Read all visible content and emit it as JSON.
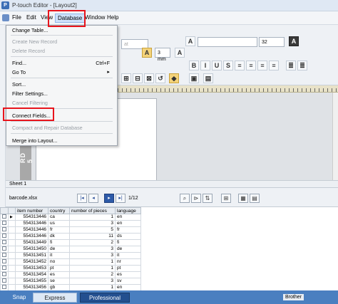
{
  "window": {
    "title": "P-touch Editor - [Layout2]"
  },
  "menubar": {
    "items": [
      "File",
      "Edit",
      "View",
      "Database",
      "Window",
      "Help"
    ],
    "active": "Database"
  },
  "database_menu": {
    "items": [
      {
        "label": "Change Table...",
        "shortcut": "",
        "disabled": false
      },
      {
        "label": "Create New Record",
        "shortcut": "",
        "disabled": true
      },
      {
        "label": "Delete Record",
        "shortcut": "",
        "disabled": true
      },
      {
        "label": "Find...",
        "shortcut": "Ctrl+F",
        "disabled": false
      },
      {
        "label": "Go To",
        "shortcut": "▸",
        "disabled": false
      },
      {
        "label": "Sort...",
        "shortcut": "",
        "disabled": false
      },
      {
        "label": "Filter Settings...",
        "shortcut": "",
        "disabled": false
      },
      {
        "label": "Cancel Filtering",
        "shortcut": "",
        "disabled": true
      },
      {
        "label": "Connect Fields...",
        "shortcut": "",
        "disabled": false
      },
      {
        "label": "Compact and Repair Database",
        "shortcut": "",
        "disabled": true
      },
      {
        "label": "Merge into Layout...",
        "shortcut": "",
        "disabled": false
      }
    ]
  },
  "toolbar": {
    "font_size": "32",
    "length": "3 mm"
  },
  "canvas": {
    "vertical_text": "RD 5",
    "sheet_tab": "Sheet 1"
  },
  "database": {
    "file": "barcode.xlsx",
    "page_indicator": "1/12",
    "columns": [
      "item number",
      "country",
      "number of pieces",
      "language"
    ],
    "rows": [
      [
        "554313446",
        "ca",
        "1",
        "en"
      ],
      [
        "554313446",
        "us",
        "3",
        "en"
      ],
      [
        "554313446",
        "fr",
        "5",
        "fr"
      ],
      [
        "554313446",
        "dk",
        "11",
        "ds"
      ],
      [
        "554313449",
        "fi",
        "2",
        "fi"
      ],
      [
        "554313450",
        "de",
        "3",
        "de"
      ],
      [
        "554313451",
        "it",
        "3",
        "it"
      ],
      [
        "554313452",
        "no",
        "1",
        "nr"
      ],
      [
        "554313453",
        "pt",
        "1",
        "pt"
      ],
      [
        "554313454",
        "es",
        "2",
        "es"
      ],
      [
        "554313455",
        "se",
        "3",
        "sv"
      ],
      [
        "554313456",
        "gb",
        "1",
        "en"
      ]
    ]
  },
  "statusbar": {
    "modes": [
      "Snap",
      "Express",
      "Professional"
    ],
    "printer": "Brother"
  },
  "colors": {
    "highlight": "#e8141c",
    "accent": "#2d5aa8"
  }
}
